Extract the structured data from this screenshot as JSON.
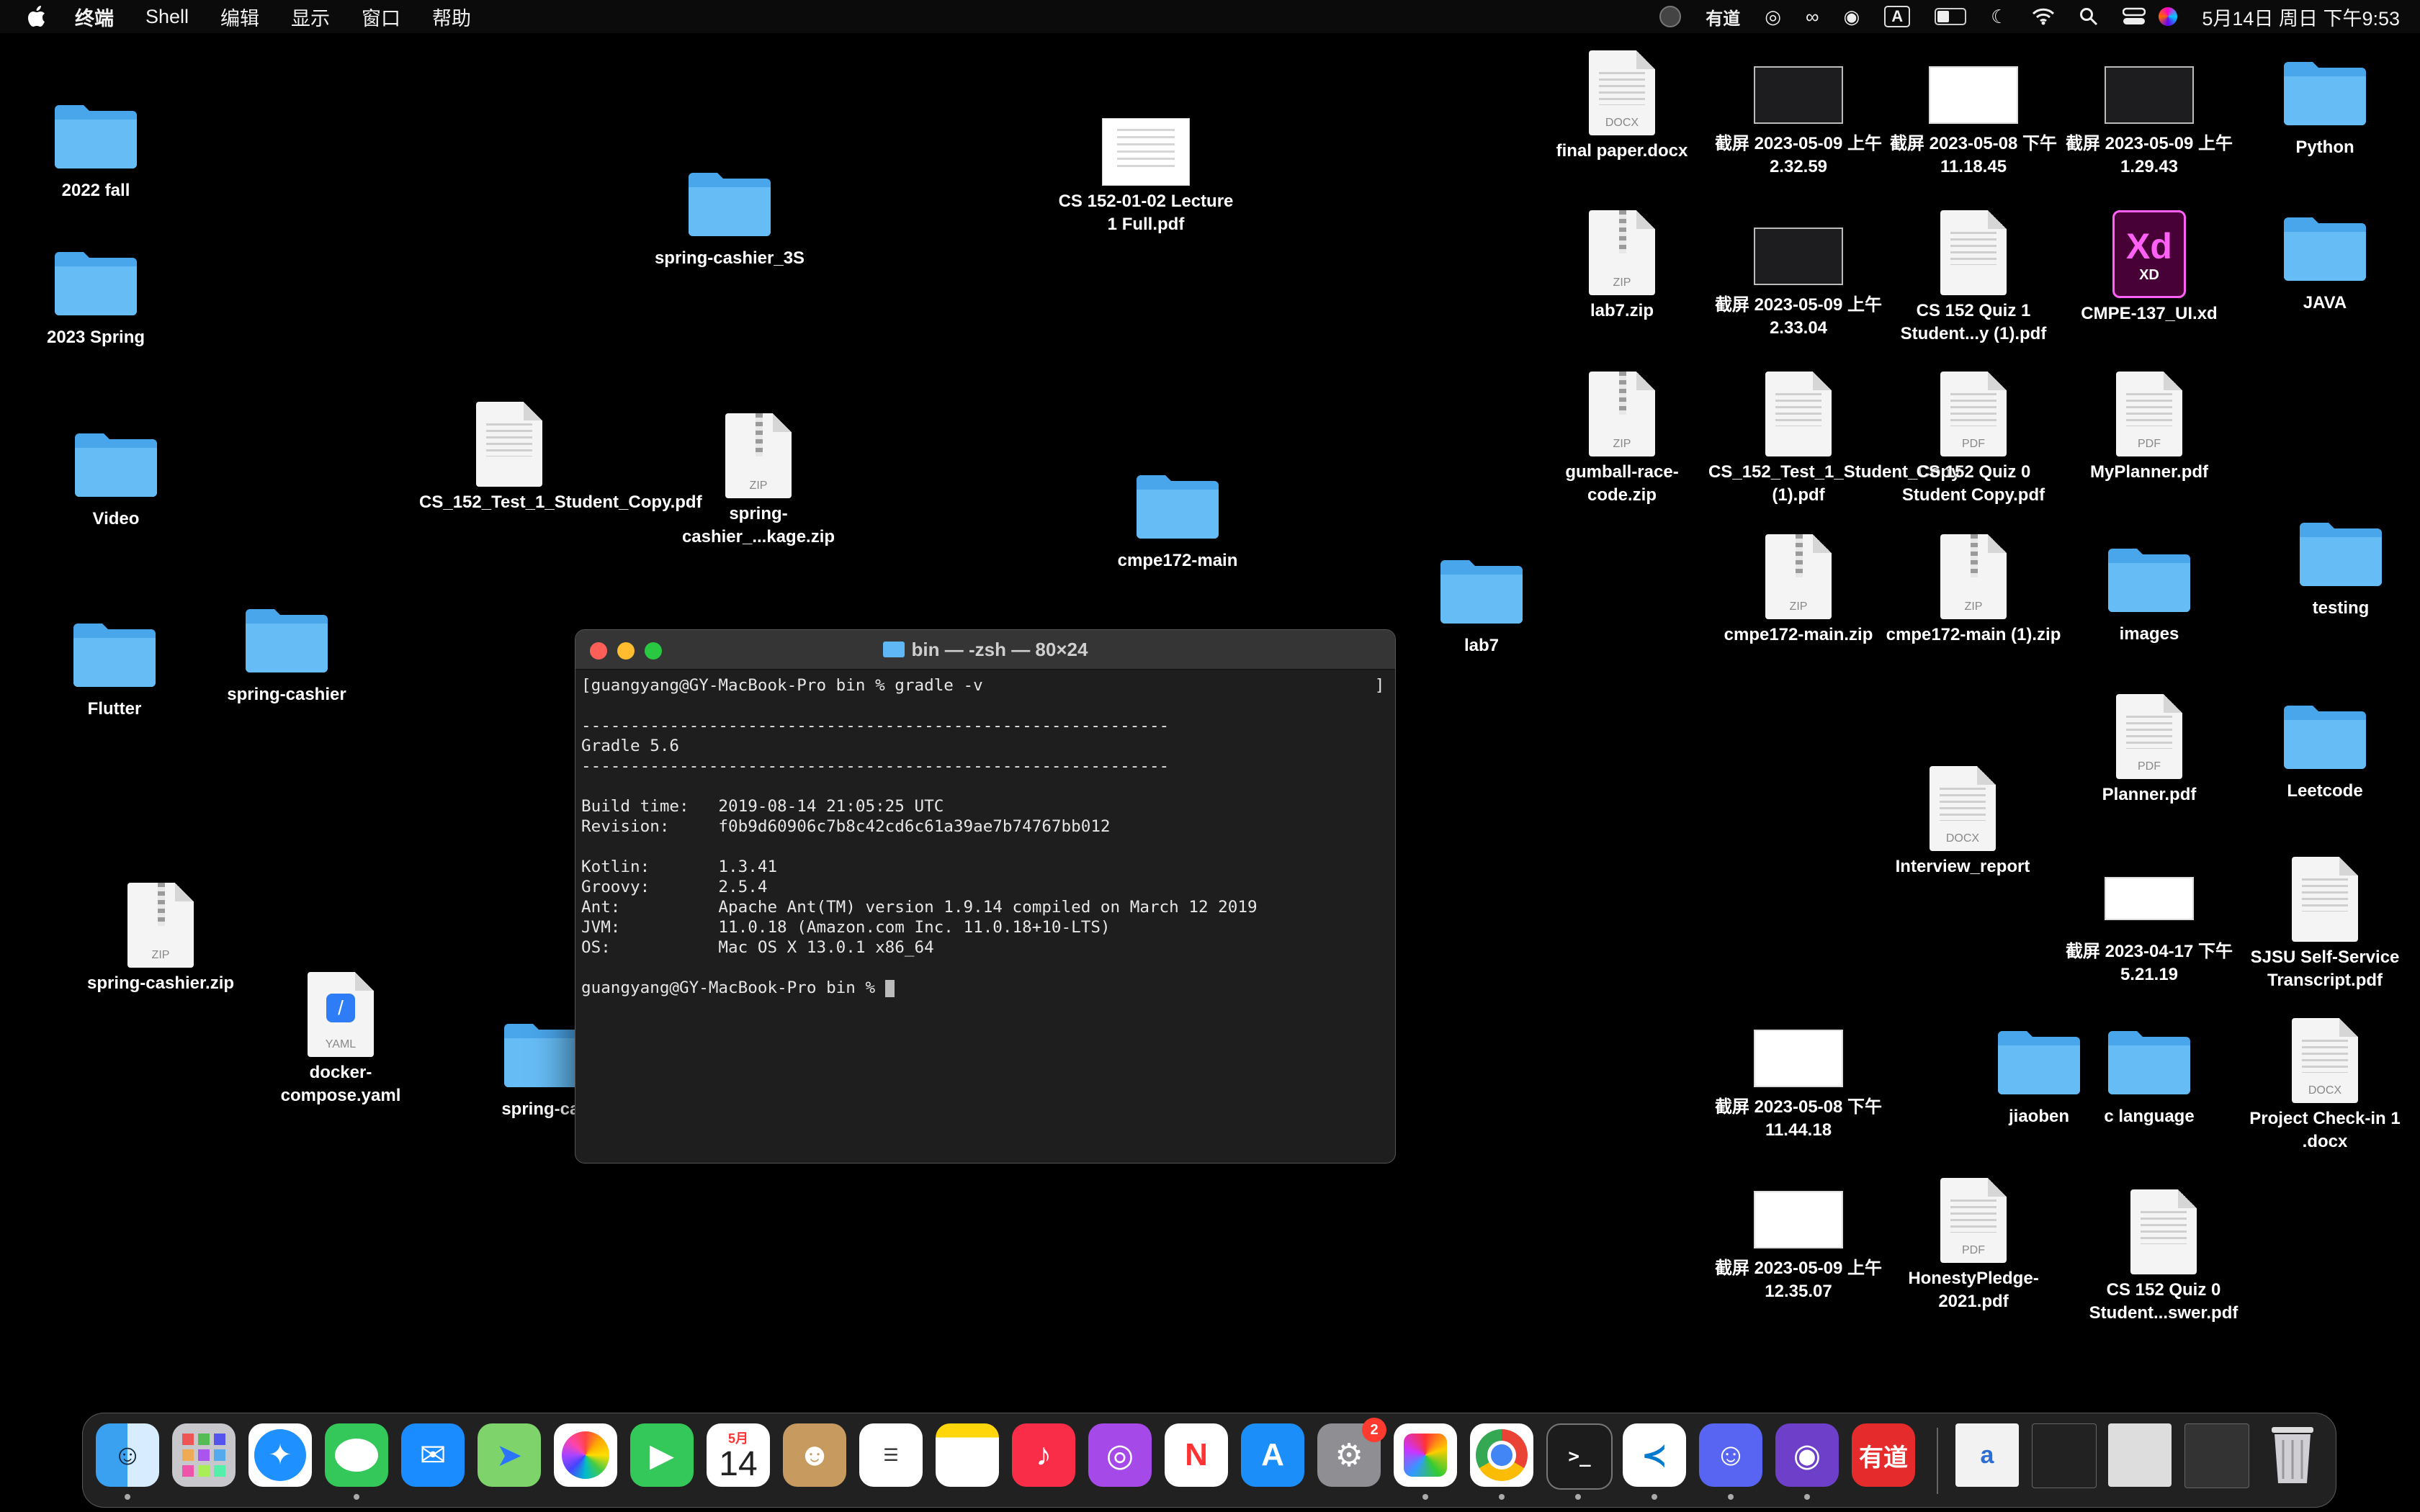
{
  "menubar": {
    "app_name": "终端",
    "menus": [
      "Shell",
      "编辑",
      "显示",
      "窗口",
      "帮助"
    ],
    "status_icons": [
      "record-icon",
      "youdao-icon",
      "weibo-icon",
      "creative-cloud-icon",
      "user-icon",
      "input-method-icon",
      "battery-icon",
      "focus-moon-icon",
      "wifi-icon",
      "spotlight-icon",
      "control-center-icon",
      "siri-icon"
    ],
    "youdao": "有道",
    "input_method": "A",
    "clock": "5月14日 周日 下午9:53"
  },
  "desktop": {
    "folder_2022_fall": "2022 fall",
    "folder_2023_spring": "2023 Spring",
    "folder_video": "Video",
    "folder_flutter": "Flutter",
    "folder_spring_cashier": "spring-cashier",
    "folder_spring_cashier_3s": "spring-cashier_3S",
    "file_cs152_lecture": "CS 152-01-02 Lecture 1 Full.pdf",
    "file_cs152_test1": "CS_152_Test_1_Student_Copy.pdf",
    "file_spring_cashier_pkg_zip": "spring-cashier_...kage.zip",
    "folder_cmpe172_main": "cmpe172-main",
    "folder_lab7": "lab7",
    "file_spring_cashier_zip": "spring-cashier.zip",
    "file_docker_compose": "docker-compose.yaml",
    "folder_spring_cas_partial": "spring-cas",
    "file_final_paper": "final paper.docx",
    "shot_0509_232": "截屏 2023-05-09 上午2.32.59",
    "shot_0508_1118": "截屏 2023-05-08 下午11.18.45",
    "shot_0509_129": "截屏 2023-05-09 上午1.29.43",
    "folder_python": "Python",
    "file_lab7_zip": "lab7.zip",
    "shot_0509_233": "截屏 2023-05-09 上午2.33.04",
    "file_cs152_quiz1": "CS 152 Quiz 1 Student...y (1).pdf",
    "file_cmpe137_xd": "CMPE-137_UI.xd",
    "folder_java": "JAVA",
    "file_gumball_zip": "gumball-race-code.zip",
    "file_cs152_test1_copy1": "CS_152_Test_1_Student_Copy (1).pdf",
    "file_cs152_quiz0": "CS 152 Quiz 0 Student Copy.pdf",
    "file_myplanner": "MyPlanner.pdf",
    "file_cmpe172_zip": "cmpe172-main.zip",
    "file_cmpe172_zip1": "cmpe172-main (1).zip",
    "folder_images": "images",
    "folder_testing": "testing",
    "file_planner": "Planner.pdf",
    "folder_leetcode": "Leetcode",
    "file_interview": "Interview_report",
    "shot_0417": "截屏 2023-04-17 下午5.21.19",
    "file_sjsu_transcript": "SJSU Self-Service Transcript.pdf",
    "shot_0508_1144": "截屏 2023-05-08 下午11.44.18",
    "folder_jiaoben": "jiaoben",
    "folder_c_language": "c language",
    "file_project_checkin": "Project Check-in 1 .docx",
    "shot_0509_1235": "截屏 2023-05-09 上午12.35.07",
    "file_honesty": "HonestyPledge-2021.pdf",
    "file_cs152_quiz0_answer": "CS 152 Quiz 0 Student...swer.pdf",
    "tag_docx": "DOCX",
    "tag_zip": "ZIP",
    "tag_pdf": "PDF",
    "tag_yaml": "YAML",
    "xd_letters": "Xd",
    "xd_tag": "XD"
  },
  "terminal": {
    "title": "bin — -zsh — 80×24",
    "output": "[guangyang@GY-MacBook-Pro bin % gradle -v                                        ]\n\n------------------------------------------------------------\nGradle 5.6\n------------------------------------------------------------\n\nBuild time:   2019-08-14 21:05:25 UTC\nRevision:     f0b9d60906c7b8c42cd6c61a39ae7b74767bb012\n\nKotlin:       1.3.41\nGroovy:       2.5.4\nAnt:          Apache Ant(TM) version 1.9.14 compiled on March 12 2019\nJVM:          11.0.18 (Amazon.com Inc. 11.0.18+10-LTS)\nOS:           Mac OS X 13.0.1 x86_64\n\n",
    "prompt": "guangyang@GY-MacBook-Pro bin % "
  },
  "dock": {
    "apps": [
      "finder-icon",
      "launchpad-icon",
      "safari-icon",
      "messages-icon",
      "mail-icon",
      "maps-icon",
      "photos-icon",
      "facetime-icon",
      "calendar-icon",
      "contacts-icon",
      "reminders-icon",
      "notes-icon",
      "music-icon",
      "podcasts-icon",
      "news-icon",
      "app-store-icon",
      "system-settings-icon",
      "pixelmator-icon",
      "chrome-icon",
      "terminal-icon",
      "vscode-icon",
      "discord-icon",
      "github-desktop-icon",
      "youdao-dict-icon"
    ],
    "calendar_month": "5月",
    "calendar_day": "14",
    "settings_badge": "2",
    "youdao_label": "有道",
    "terminal_glyph": ">_",
    "trash": "trash-icon"
  },
  "colors": {
    "folder_blue": "#5fb8f5",
    "close": "#ff5f57",
    "minimize": "#febc2e",
    "zoom": "#28c840",
    "terminal_bg": "#1e1e1e"
  }
}
